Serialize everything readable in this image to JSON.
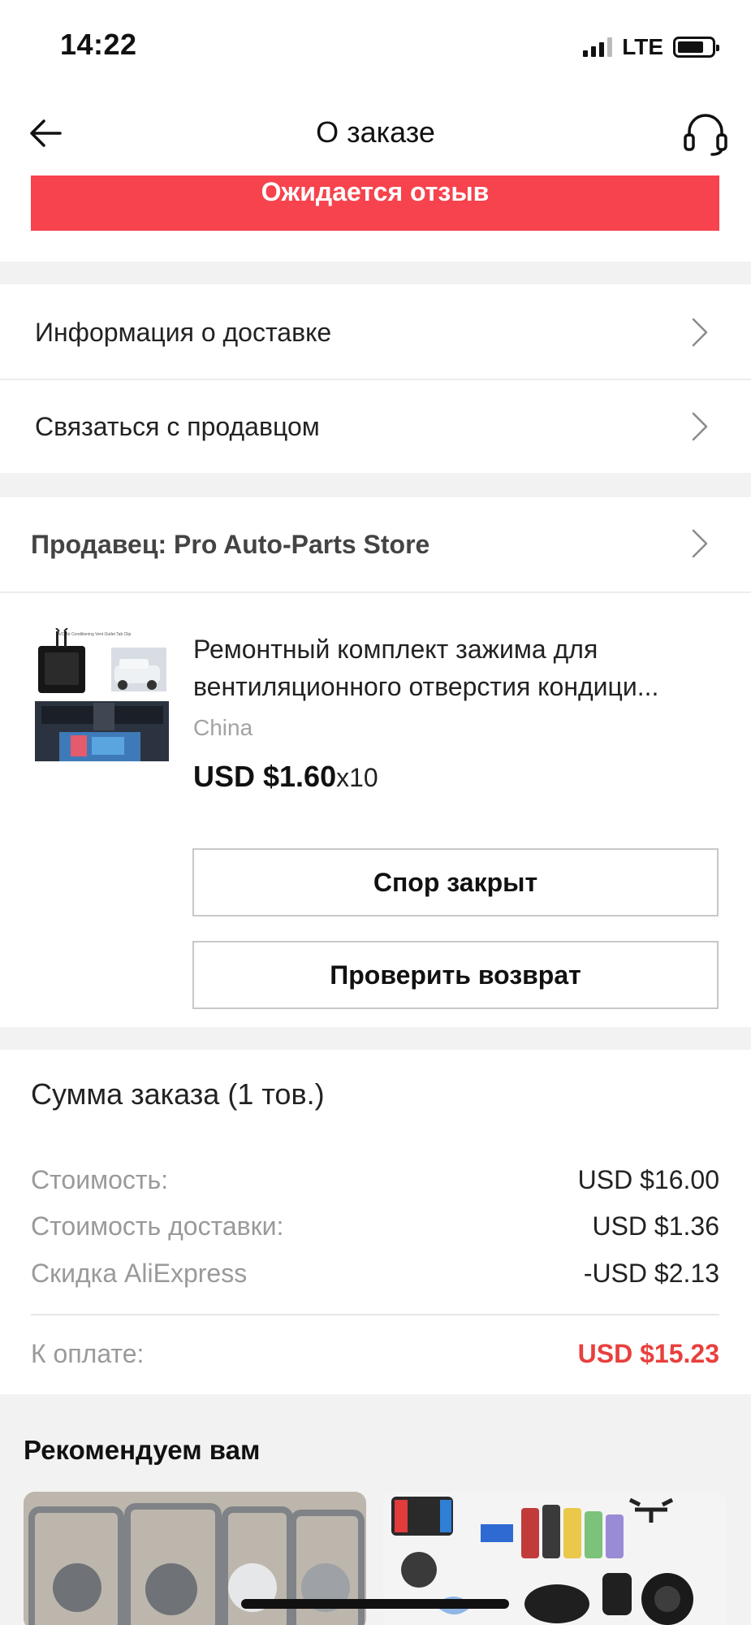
{
  "status_bar": {
    "time": "14:22",
    "network": "LTE"
  },
  "header": {
    "title": "О заказе",
    "back_icon": "arrow-left-icon",
    "support_icon": "headset-icon"
  },
  "order_status": {
    "label": "Ожидается отзыв",
    "color": "#f6434d"
  },
  "menu": {
    "delivery_info": "Информация о доставке",
    "contact_seller": "Связаться с продавцом"
  },
  "seller": {
    "label": "Продавец: Pro Auto-Parts Store"
  },
  "product": {
    "title": "Ремонтный комплект зажима для вентиляционного отверстия кондици...",
    "origin": "China",
    "price": "USD $1.60",
    "quantity": "x10",
    "thumb_caption": "A/C Air Conditioning Vent Outlet Tab Clip",
    "actions": {
      "dispute": "Спор закрыт",
      "check_return": "Проверить возврат"
    }
  },
  "summary": {
    "title": "Сумма заказа (1 тов.)",
    "cost_label": "Стоимость:",
    "cost_value": "USD $16.00",
    "shipping_label": "Стоимость доставки:",
    "shipping_value": "USD $1.36",
    "discount_label": "Скидка AliExpress",
    "discount_value": "-USD $2.13",
    "total_label": "К оплате:",
    "total_value": "USD $15.23",
    "total_color": "#e8403c"
  },
  "recommendations": {
    "title": "Рекомендуем вам"
  }
}
